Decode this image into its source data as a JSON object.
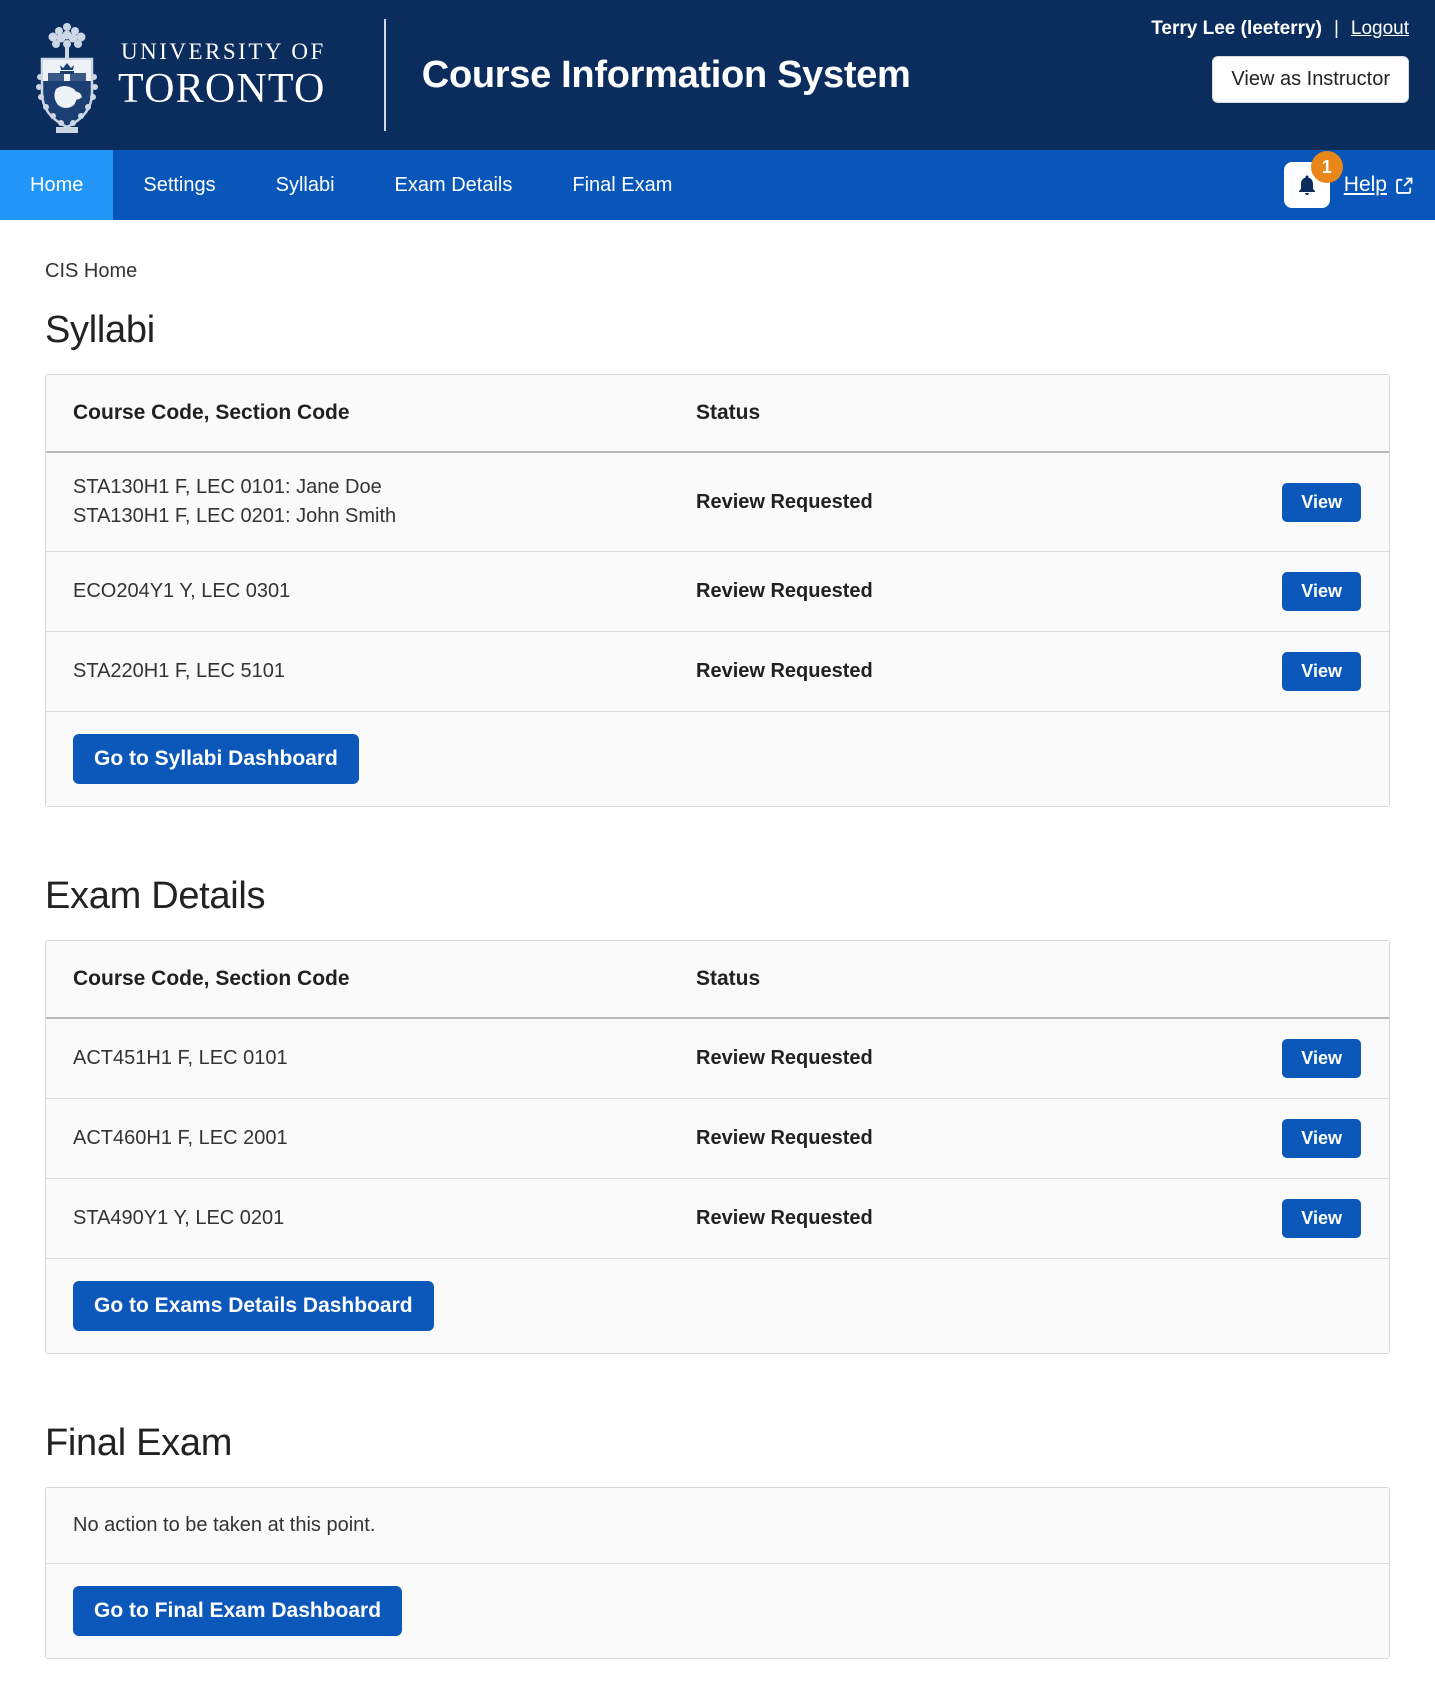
{
  "header": {
    "logo_line1": "UNIVERSITY OF",
    "logo_line2": "TORONTO",
    "app_title": "Course Information System",
    "user_name": "Terry Lee (leeterry)",
    "separator": "|",
    "logout_label": "Logout",
    "view_as_instructor_label": "View as Instructor"
  },
  "nav": {
    "items": [
      {
        "label": "Home",
        "active": true
      },
      {
        "label": "Settings",
        "active": false
      },
      {
        "label": "Syllabi",
        "active": false
      },
      {
        "label": "Exam Details",
        "active": false
      },
      {
        "label": "Final Exam",
        "active": false
      }
    ],
    "notification_count": "1",
    "help_label": "Help"
  },
  "breadcrumb": "CIS Home",
  "sections": {
    "syllabi": {
      "title": "Syllabi",
      "columns": {
        "course": "Course Code, Section Code",
        "status": "Status"
      },
      "rows": [
        {
          "courses": [
            "STA130H1 F, LEC 0101: Jane Doe",
            "STA130H1 F, LEC 0201: John Smith"
          ],
          "status": "Review Requested",
          "action": "View"
        },
        {
          "courses": [
            "ECO204Y1 Y, LEC 0301"
          ],
          "status": "Review Requested",
          "action": "View"
        },
        {
          "courses": [
            "STA220H1 F, LEC 5101"
          ],
          "status": "Review Requested",
          "action": "View"
        }
      ],
      "dashboard_label": "Go to Syllabi Dashboard"
    },
    "exam_details": {
      "title": "Exam Details",
      "columns": {
        "course": "Course Code, Section Code",
        "status": "Status"
      },
      "rows": [
        {
          "courses": [
            "ACT451H1 F, LEC 0101"
          ],
          "status": "Review Requested",
          "action": "View"
        },
        {
          "courses": [
            "ACT460H1 F, LEC 2001"
          ],
          "status": "Review Requested",
          "action": "View"
        },
        {
          "courses": [
            "STA490Y1 Y, LEC 0201"
          ],
          "status": "Review Requested",
          "action": "View"
        }
      ],
      "dashboard_label": "Go to Exams Details Dashboard"
    },
    "final_exam": {
      "title": "Final Exam",
      "empty_message": "No action to be taken at this point.",
      "dashboard_label": "Go to Final Exam Dashboard"
    }
  },
  "colors": {
    "header_navy": "#0a2d5e",
    "nav_blue": "#0956bb",
    "nav_active_blue": "#2196f8",
    "button_blue": "#0b58ba",
    "badge_orange": "#e8861a"
  }
}
